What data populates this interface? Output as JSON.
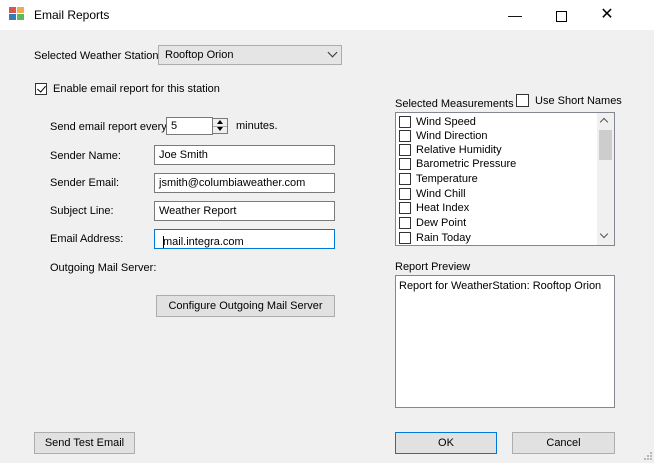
{
  "window": {
    "title": "Email Reports",
    "controls": {
      "minimize": "—",
      "close": "✕"
    }
  },
  "station": {
    "label": "Selected Weather Station",
    "value": "Rooftop Orion"
  },
  "enable": {
    "label": "Enable email report for this station",
    "checked": true
  },
  "form": {
    "send_every_label": "Send email report every",
    "interval_value": "5",
    "minutes_label": "minutes.",
    "sender_name_label": "Sender Name:",
    "sender_name_value": "Joe Smith",
    "sender_email_label": "Sender Email:",
    "sender_email_value": "jsmith@columbiaweather.com",
    "subject_label": "Subject Line:",
    "subject_value": "Weather Report",
    "email_address_label": "Email Address:",
    "email_address_value": "mail.integra.com",
    "outgoing_label": "Outgoing Mail Server:",
    "configure_button": "Configure Outgoing Mail Server"
  },
  "measurements": {
    "label": "Selected Measurements",
    "short_names_label": "Use Short Names",
    "items": [
      "Wind Speed",
      "Wind Direction",
      "Relative Humidity",
      "Barometric Pressure",
      "Temperature",
      "Wind Chill",
      "Heat Index",
      "Dew Point",
      "Rain Today"
    ]
  },
  "preview": {
    "label": "Report Preview",
    "text": "Report for WeatherStation: Rooftop Orion"
  },
  "buttons": {
    "send_test": "Send Test Email",
    "ok": "OK",
    "cancel": "Cancel"
  }
}
